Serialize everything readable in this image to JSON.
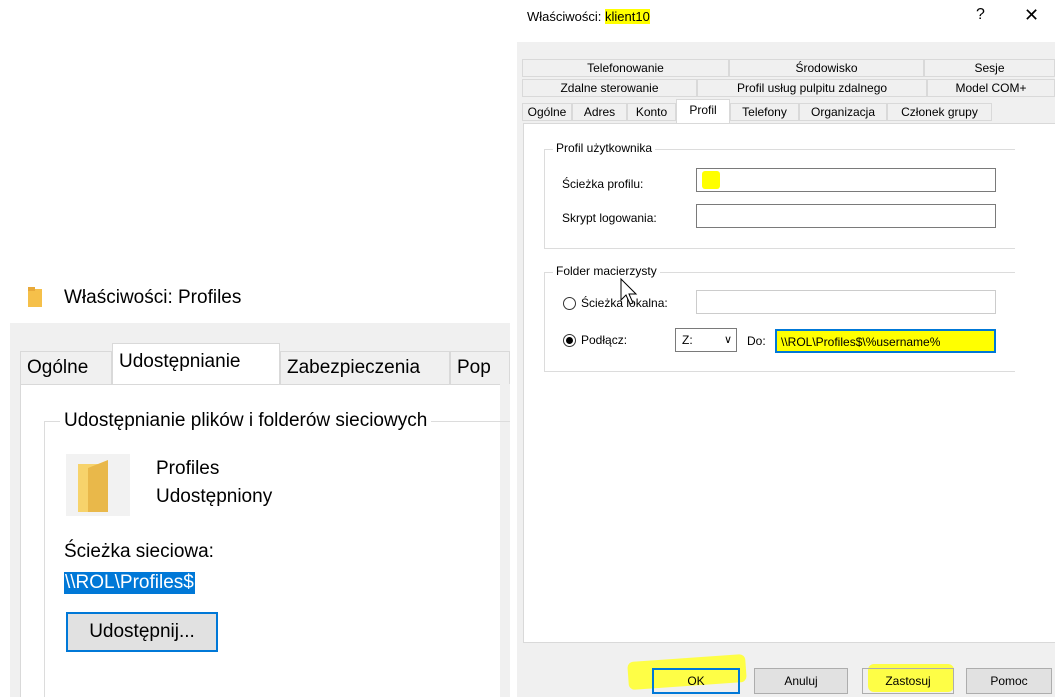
{
  "left_window": {
    "title": "Właściwości: Profiles",
    "tabs": [
      "Ogólne",
      "Udostępnianie",
      "Zabezpieczenia",
      "Pop"
    ],
    "active_tab": "Udostępnianie",
    "group_label": "Udostępnianie plików i folderów sieciowych",
    "folder_name": "Profiles",
    "folder_status": "Udostępniony",
    "network_path_label": "Ścieżka sieciowa:",
    "network_path_value": "\\\\ROL\\Profiles$",
    "share_button": "Udostępnij..."
  },
  "right_dialog": {
    "title_prefix": "Właściwości: ",
    "title_user": "klient10",
    "help_glyph": "?",
    "close_glyph": "✕",
    "tabs_row1": [
      "Telefonowanie",
      "Środowisko",
      "Sesje"
    ],
    "tabs_row2": [
      "Zdalne sterowanie",
      "Profil usług pulpitu zdalnego",
      "Model COM+"
    ],
    "tabs_row3": [
      "Ogólne",
      "Adres",
      "Konto",
      "Profil",
      "Telefony",
      "Organizacja",
      "Członek grupy"
    ],
    "active_tab": "Profil",
    "profile_group": {
      "label": "Profil użytkownika",
      "profile_path_label": "Ścieżka profilu:",
      "profile_path_value": "",
      "logon_script_label": "Skrypt logowania:",
      "logon_script_value": ""
    },
    "home_folder_group": {
      "label": "Folder macierzysty",
      "local_path_label": "Ścieżka lokalna:",
      "local_path_value": "",
      "connect_label": "Podłącz:",
      "drive_value": "Z:",
      "to_label": "Do:",
      "to_value": "\\\\ROL\\Profiles$\\%username%"
    },
    "buttons": {
      "ok": "OK",
      "cancel": "Anuluj",
      "apply": "Zastosuj",
      "help": "Pomoc"
    },
    "highlight_color": "#ffff00",
    "accent_color": "#0078d7"
  }
}
